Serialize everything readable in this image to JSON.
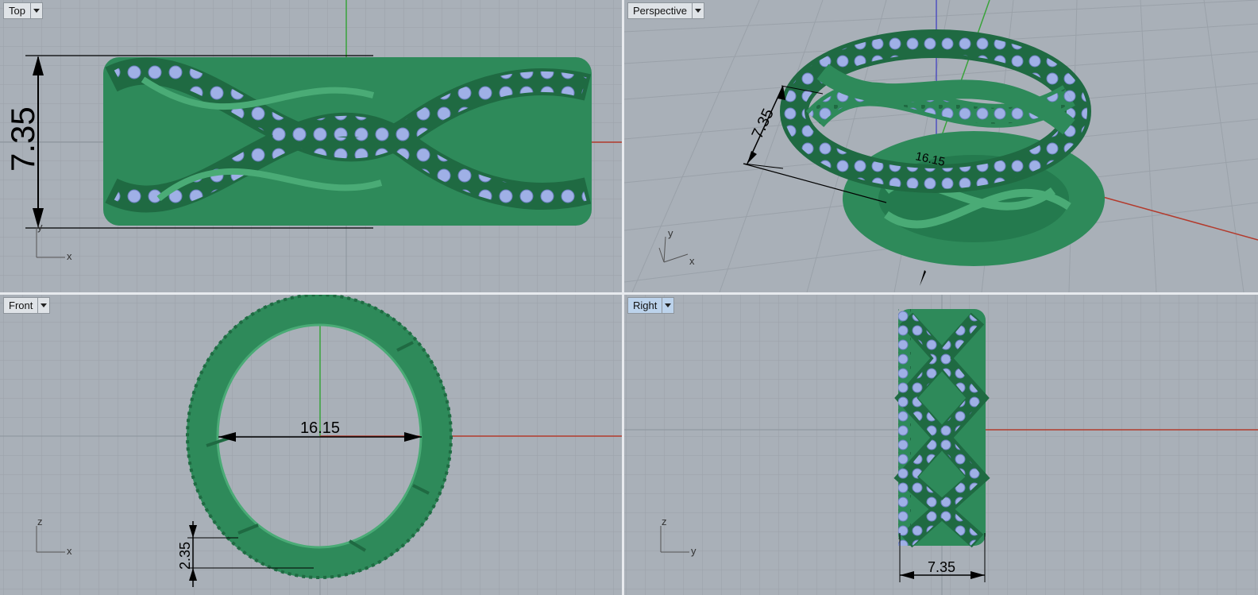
{
  "viewports": {
    "top": {
      "title": "Top",
      "dimension": "7.35",
      "axes": {
        "h": "x",
        "v": "y"
      }
    },
    "perspective": {
      "title": "Perspective",
      "dimensions": {
        "height": "7.35",
        "diameter": "16.15"
      },
      "axes": {
        "h": "x",
        "v": "y"
      }
    },
    "front": {
      "title": "Front",
      "dimensions": {
        "diameter": "16.15",
        "thickness": "2.35"
      },
      "axes": {
        "h": "x",
        "v": "z"
      }
    },
    "right": {
      "title": "Right",
      "dimension": "7.35",
      "axes": {
        "h": "y",
        "v": "z"
      },
      "active": true
    }
  },
  "colors": {
    "background": "#a9b0b8",
    "grid_minor": "#9aa1a9",
    "grid_major": "#8c949c",
    "metal": "#2e8a5a",
    "metal_dark": "#1f6a42",
    "metal_light": "#4aab76",
    "gem": "#9fb0e6",
    "x_axis": "#b33a2c",
    "y_axis": "#39a33a",
    "z_axis": "#5050c0",
    "active_tab": "#bcd3ec"
  },
  "icons": {
    "tab_menu": "caret-down-icon"
  }
}
